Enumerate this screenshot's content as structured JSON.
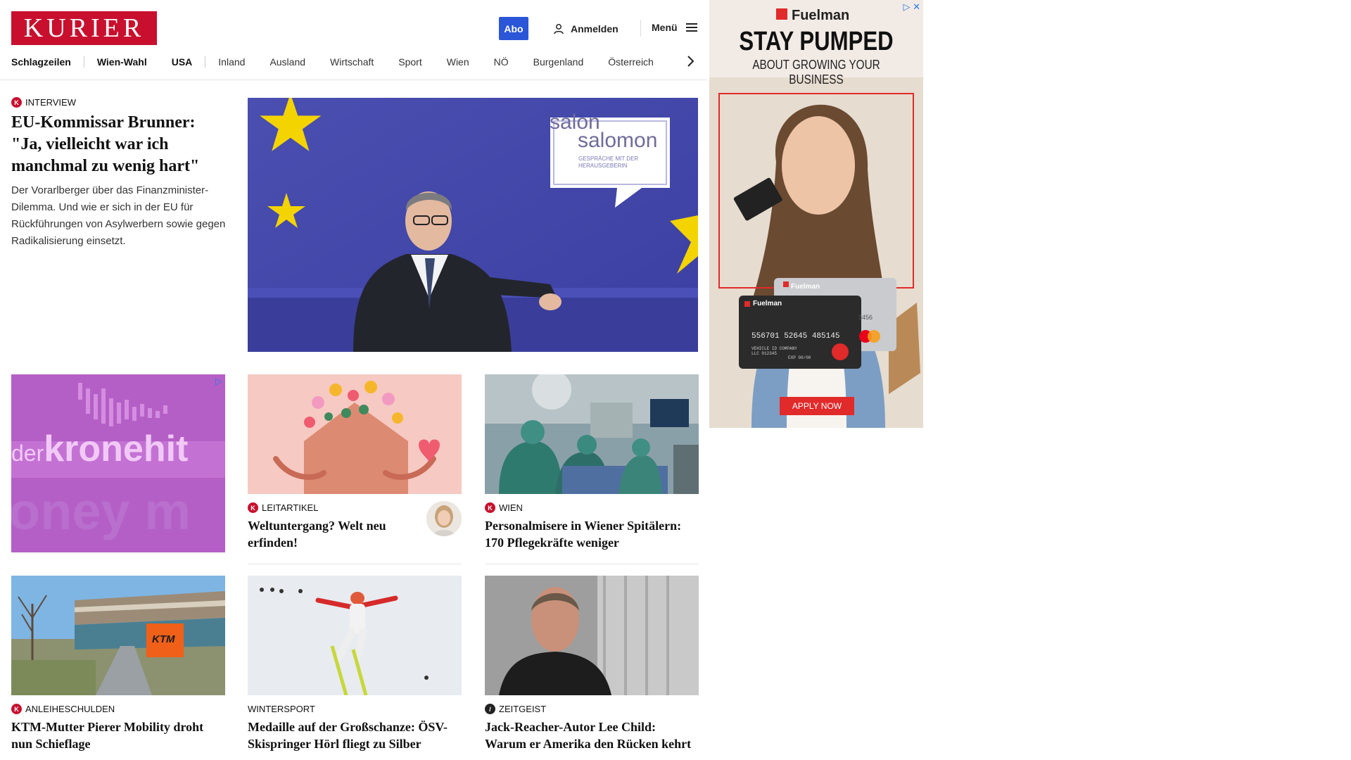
{
  "header": {
    "logo": "KURIER",
    "abo_label": "Abo",
    "login_label": "Anmelden",
    "menu_label": "Menü"
  },
  "nav": [
    {
      "label": "Schlagzeilen",
      "bold": true
    },
    {
      "label": "Wien-Wahl",
      "bold": true
    },
    {
      "label": "USA",
      "bold": true
    },
    {
      "label": "Inland"
    },
    {
      "label": "Ausland"
    },
    {
      "label": "Wirtschaft"
    },
    {
      "label": "Sport"
    },
    {
      "label": "Wien"
    },
    {
      "label": "NÖ"
    },
    {
      "label": "Burgenland"
    },
    {
      "label": "Österreich"
    }
  ],
  "lead": {
    "category": "INTERVIEW",
    "title": "EU-Kommissar Brunner: \"Ja, vielleicht war ich manchmal zu wenig hart\"",
    "teaser": "Der Vorarlberger über das Finanzminister-Dilemma. Und wie er sich in der EU für Rückführungen von Asylwerbern sowie gegen Radikalisierung einsetzt.",
    "badge_line1": "salon",
    "badge_line2": "salomon",
    "badge_sub": "GESPRÄCHE MIT DER HERAUSGEBERIN"
  },
  "ad_small": {
    "brand_a": "der",
    "brand_b": "kronehit",
    "bg_text": "oney m"
  },
  "articles": [
    {
      "category": "LEITARTIKEL",
      "title": "Weltuntergang? Welt neu erfinden!",
      "icon": "k-logo-red"
    },
    {
      "category": "WIEN",
      "title": "Personalmisere in Wiener Spitälern: 170 Pflegekräfte weniger",
      "icon": "k-logo-red"
    },
    {
      "category": "ANLEIHESCHULDEN",
      "title": "KTM-Mutter Pierer Mobility droht nun Schieflage",
      "icon": "k-logo-red"
    },
    {
      "category": "WINTERSPORT",
      "title": "Medaille auf der Großschanze: ÖSV-Skispringer Hörl fliegt zu Silber",
      "icon": ""
    },
    {
      "category": "ZEITGEIST",
      "title": "Jack-Reacher-Autor Lee Child: Warum er Amerika den Rücken kehrt",
      "icon": "zeitgeist-logo-dark"
    }
  ],
  "ktm_sign": "KTM",
  "ad_right": {
    "brand": "Fuelman",
    "headline": "STAY PUMPED",
    "subline": "ABOUT GROWING YOUR BUSINESS",
    "card_brand": "Fuelman",
    "card_number": "556701 52645 485145",
    "card_meta": "VEHICLE ID COMPANY LLC 012345",
    "card_exp": "EXP 00/00",
    "card_back_digits": "3456",
    "cta": "APPLY NOW"
  },
  "colors": {
    "brand_red": "#c8102e",
    "abo_blue": "#2b56d8"
  }
}
